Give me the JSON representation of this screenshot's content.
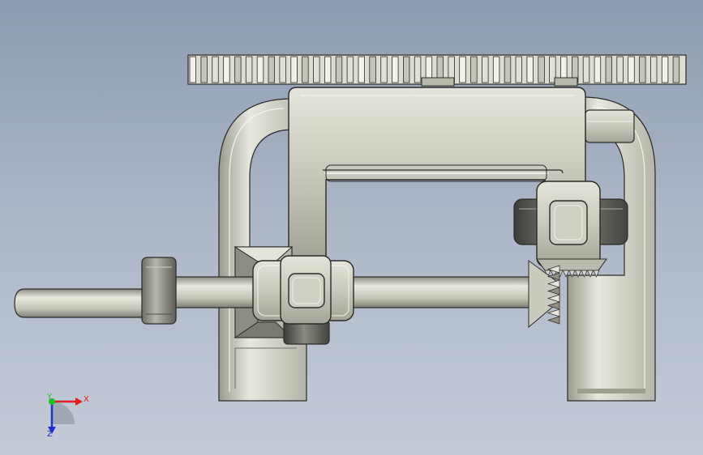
{
  "viewport": {
    "background_top": "#8d9bb0",
    "background_bottom": "#c5ccd8"
  },
  "model": {
    "metal_light": "#e6e6dc",
    "metal_mid": "#c9c9bc",
    "metal_dark": "#8f8f84",
    "edge_color": "#2b2b28",
    "gear_tooth_count": 44
  },
  "triad": {
    "x_label": "X",
    "y_label": "Y",
    "z_label": "Z",
    "x_color": "#e02020",
    "y_color": "#20c020",
    "z_color": "#2030d0"
  }
}
